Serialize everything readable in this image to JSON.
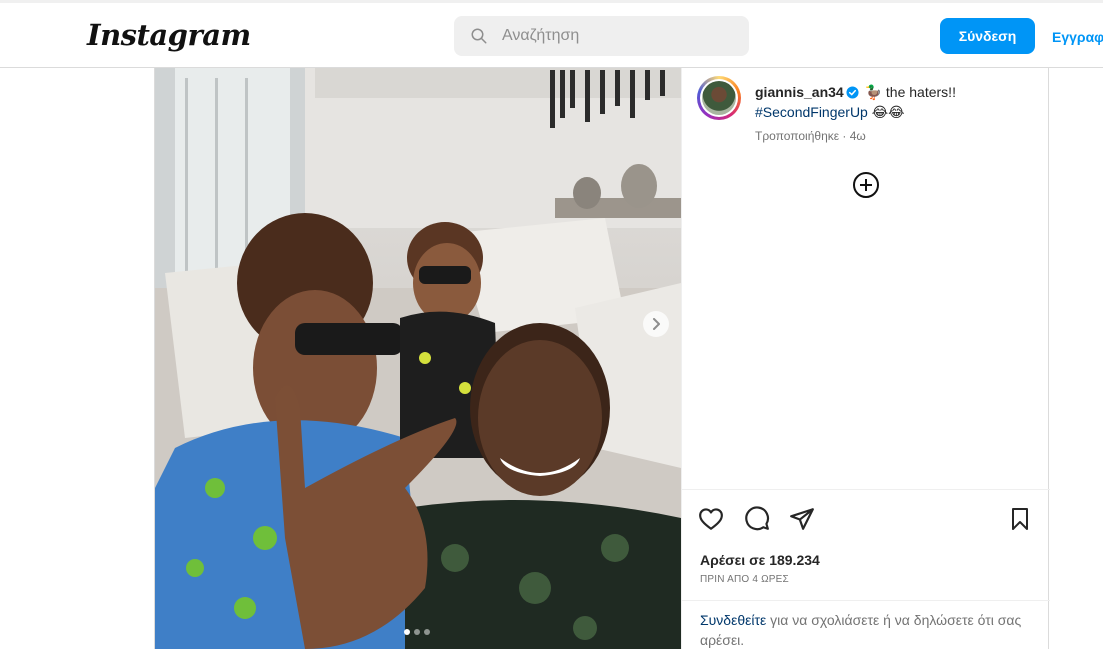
{
  "header": {
    "logo_text": "Instagram",
    "search_placeholder": "Αναζήτηση",
    "login_label": "Σύνδεση",
    "signup_label": "Εγγραφή"
  },
  "post": {
    "username": "giannis_an34",
    "caption_emoji": "🦆",
    "caption_text": " the haters!!",
    "hashtag": "#SecondFingerUp",
    "hashtag_emoji": " 😂😂",
    "edited_text": "Τροποποιήθηκε · 4ω",
    "likes_text": "Αρέσει σε 189.234",
    "time_text": "ΠΡΙΝ ΑΠΟ 4 ΩΡΕΣ",
    "login_link": "Συνδεθείτε",
    "login_rest": " για να σχολιάσετε ή να δηλώσετε ότι σας αρέσει.",
    "carousel_count": 3,
    "carousel_active": 1
  },
  "icons": {
    "search": "search-icon",
    "verified": "verified-badge-icon",
    "plus": "plus-circle-icon",
    "like": "heart-icon",
    "comment": "comment-icon",
    "share": "paper-plane-icon",
    "save": "bookmark-icon",
    "next": "chevron-right-icon"
  },
  "colors": {
    "primary": "#0095f6",
    "link": "#00376b",
    "muted": "#737373"
  }
}
